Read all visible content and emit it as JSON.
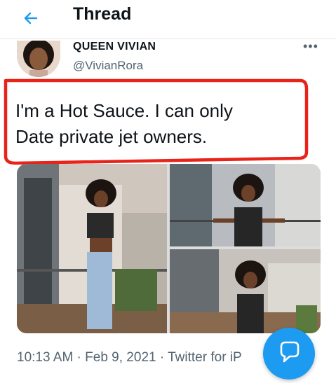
{
  "header": {
    "title": "Thread",
    "back_icon": "arrow-left-icon"
  },
  "tweet": {
    "author_name": "QUEEN VIVIAN",
    "author_handle": "@VivianRora",
    "text_line1": "I'm a Hot Sauce. I can only",
    "text_line2": "Date private jet owners.",
    "more_icon": "•••",
    "timestamp": "10:13 AM · Feb 9, 2021 · Twitter for iP",
    "photo_count": 3
  },
  "fab": {
    "icon": "speech-bubble-icon"
  },
  "colors": {
    "accent": "#1d9bf0",
    "highlight": "#e8231a"
  }
}
